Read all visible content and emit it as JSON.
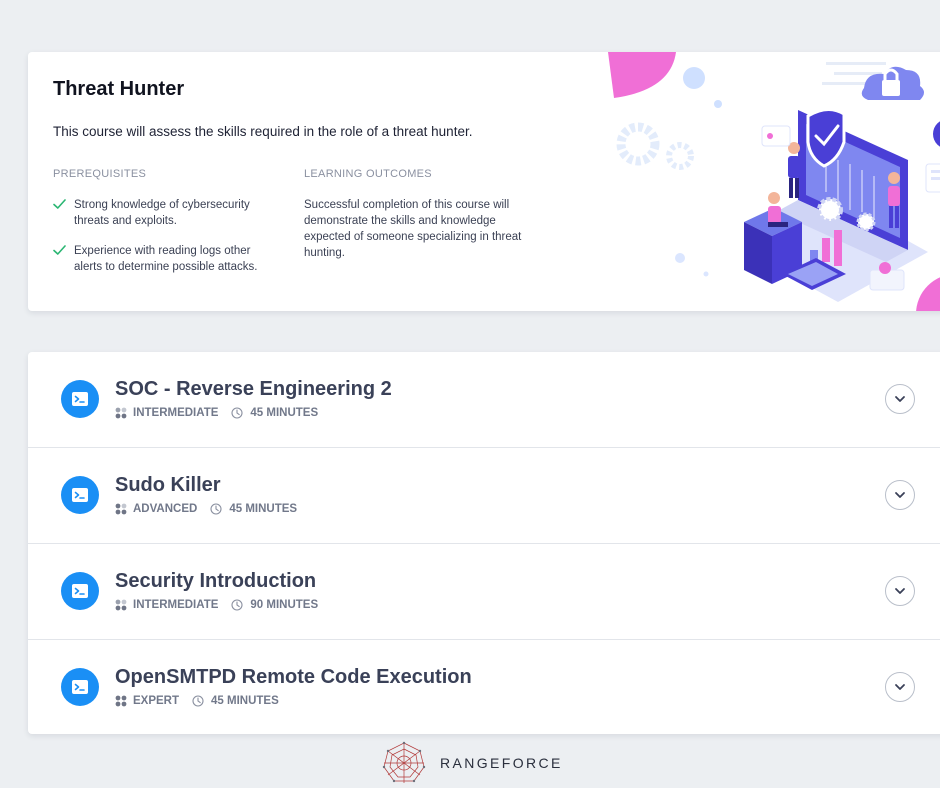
{
  "course": {
    "title": "Threat Hunter",
    "description": "This course will assess the skills required in the role of a threat hunter.",
    "prerequisites_heading": "PREREQUISITES",
    "prerequisites": [
      "Strong knowledge of cybersecurity threats and exploits.",
      "Experience with reading logs other alerts to determine possible attacks."
    ],
    "outcomes_heading": "LEARNING OUTCOMES",
    "outcomes": "Successful completion of this course will demonstrate the skills and knowledge expected of someone specializing in threat hunting."
  },
  "modules": [
    {
      "title": "SOC - Reverse Engineering 2",
      "level": "INTERMEDIATE",
      "duration": "45 MINUTES"
    },
    {
      "title": "Sudo Killer",
      "level": "ADVANCED",
      "duration": "45 MINUTES"
    },
    {
      "title": "Security Introduction",
      "level": "INTERMEDIATE",
      "duration": "90 MINUTES"
    },
    {
      "title": "OpenSMTPD Remote Code Execution",
      "level": "EXPERT",
      "duration": "45 MINUTES"
    }
  ],
  "icons": {
    "module": "terminal-icon",
    "level": "difficulty-dots-icon",
    "duration": "clock-icon",
    "expand": "chevron-down-icon",
    "prerequisite": "check-icon"
  },
  "colors": {
    "accent": "#1a8ff5",
    "check": "#2bb673",
    "illustration_primary": "#4a3fd6",
    "illustration_pink": "#f06fd6"
  },
  "brand": {
    "name": "RANGEFORCE"
  }
}
